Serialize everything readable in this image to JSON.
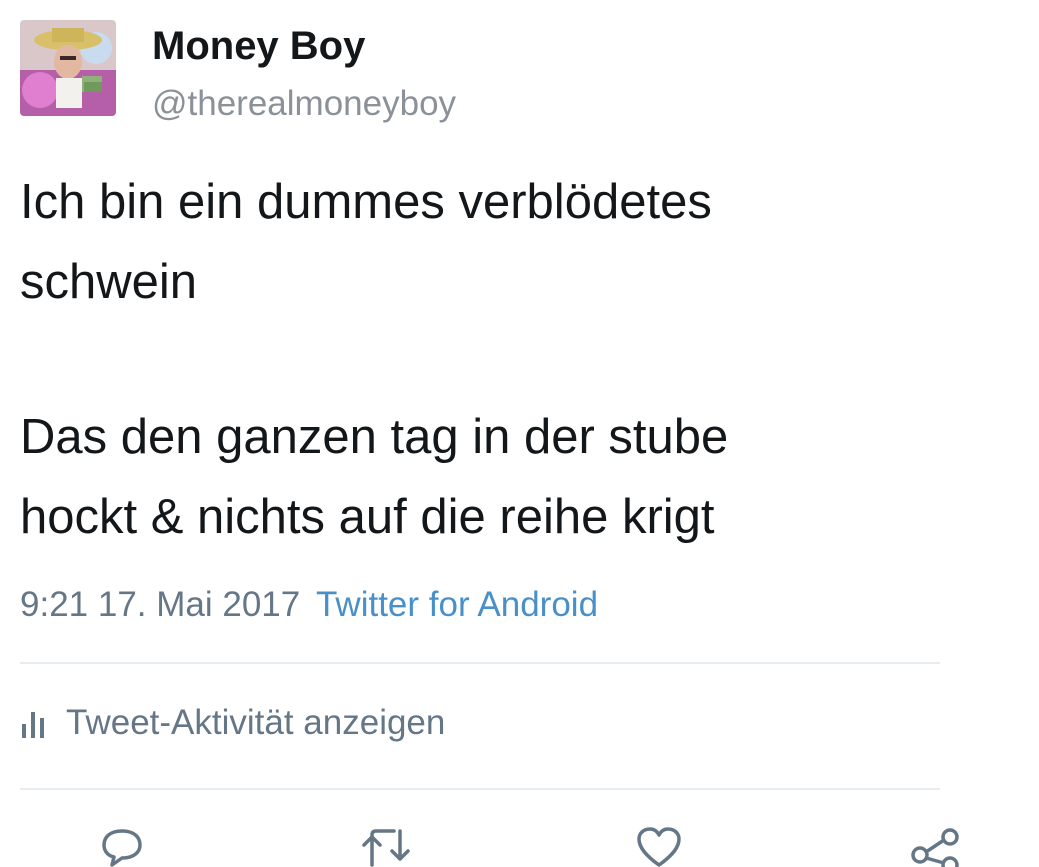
{
  "tweet": {
    "author": {
      "display_name": "Money Boy",
      "handle": "@therealmoneyboy",
      "avatar": "avatar-photo"
    },
    "text_paragraphs": [
      "Ich bin ein dummes verblödetes\nschwein",
      "Das den ganzen tag in der stube\nhockt & nichts auf die reihe krigt"
    ],
    "time": "9:21",
    "date": "17. Mai 2017",
    "source": "Twitter for Android",
    "activity_label": "Tweet-Aktivität anzeigen",
    "activity_icon": "bar-chart-icon",
    "actions": [
      {
        "name": "reply",
        "icon": "reply-icon"
      },
      {
        "name": "retweet",
        "icon": "retweet-icon"
      },
      {
        "name": "like",
        "icon": "heart-icon"
      },
      {
        "name": "share",
        "icon": "share-icon"
      }
    ]
  },
  "colors": {
    "text": "#14171a",
    "secondary": "#657786",
    "link": "#4a90c8",
    "divider": "#e6ecf0"
  }
}
